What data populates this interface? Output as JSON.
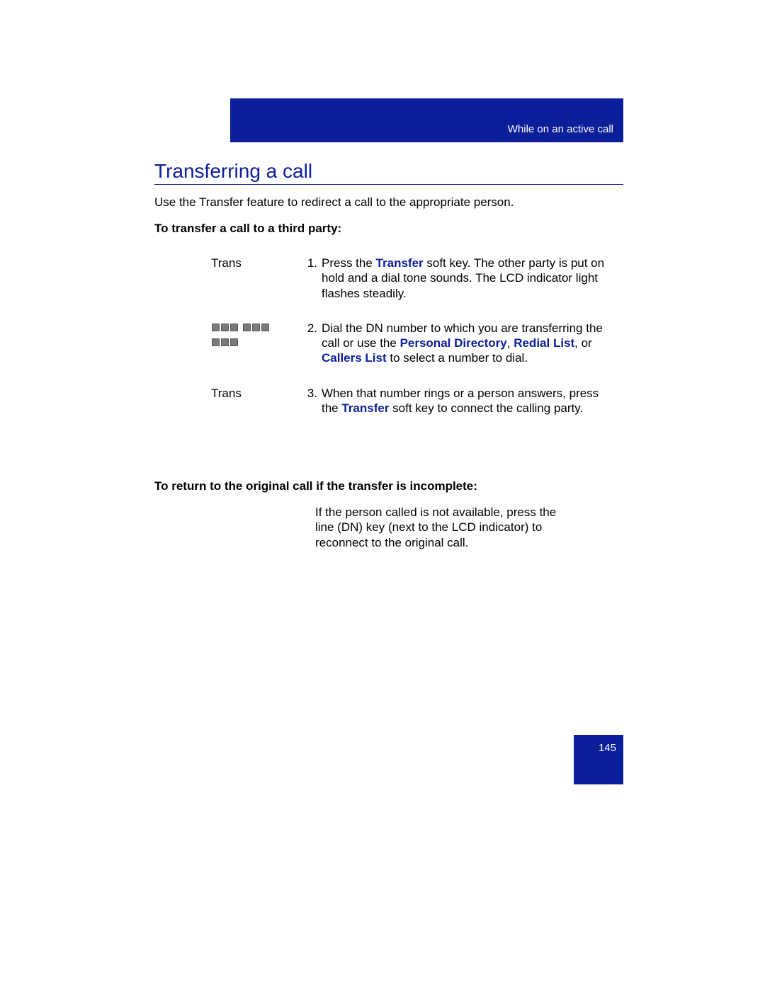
{
  "header": {
    "section_label": "While on an active call"
  },
  "heading": "Transferring a call",
  "intro": "Use the Transfer feature to redirect a call to the appropriate person.",
  "sub1": "To transfer a call to a third party:",
  "steps": [
    {
      "left_label": "Trans",
      "num": "1.",
      "pre": "Press the ",
      "kw": "Transfer",
      "post": " soft key. The other party is put on hold and a dial tone sounds. The LCD indicator light flashes steadily."
    },
    {
      "left_label": "",
      "num": "2.",
      "pre": "Dial the DN number to which you are transferring the call or use the ",
      "kw1": "Personal Directory",
      "mid1": ", ",
      "kw2": "Redial List",
      "mid2": ", or ",
      "kw3": "Callers List",
      "post": " to select a number to dial."
    },
    {
      "left_label": "Trans",
      "num": "3.",
      "pre": "When that number rings or a person answers, press the ",
      "kw": "Transfer",
      "post": " soft key to connect the calling party."
    }
  ],
  "sub2": "To return to the original call if the transfer is incomplete:",
  "return_para": "If the person called is not available, press the line (DN) key (next to the LCD indicator) to reconnect to the original call.",
  "page_number": "145"
}
